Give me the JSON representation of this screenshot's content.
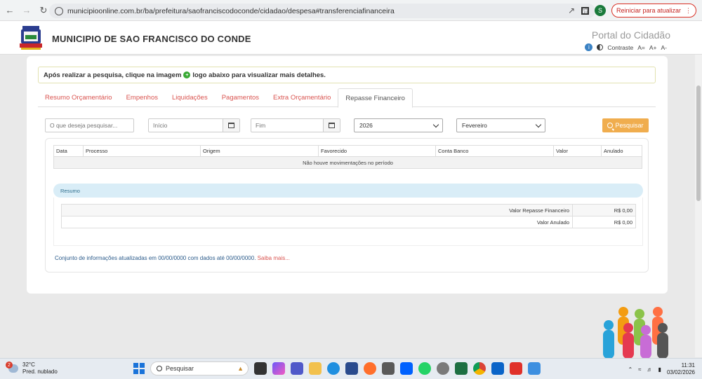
{
  "browser": {
    "url": "municipioonline.com.br/ba/prefeitura/saofranciscodoconde/cidadao/despesa#transferenciafinanceira",
    "profile_initial": "S",
    "restart_label": "Reiniciar para atualizar"
  },
  "header": {
    "municipality": "MUNICIPIO DE SAO FRANCISCO DO CONDE",
    "portal": "Portal do Cidadão",
    "contrast_label": "Contraste",
    "font_normal": "A=",
    "font_increase": "A+",
    "font_decrease": "A-"
  },
  "notice": {
    "before": "Após realizar a pesquisa, clique na imagem",
    "after": "logo abaixo para visualizar mais detalhes."
  },
  "tabs": [
    {
      "label": "Resumo Orçamentário",
      "active": false
    },
    {
      "label": "Empenhos",
      "active": false
    },
    {
      "label": "Liquidações",
      "active": false
    },
    {
      "label": "Pagamentos",
      "active": false
    },
    {
      "label": "Extra Orçamentário",
      "active": false
    },
    {
      "label": "Repasse Financeiro",
      "active": true
    }
  ],
  "filters": {
    "search_placeholder": "O que deseja pesquisar...",
    "start_placeholder": "Início",
    "end_placeholder": "Fim",
    "year": "2026",
    "month": "Fevereiro",
    "search_button": "Pesquisar"
  },
  "table": {
    "columns": [
      "Data",
      "Processo",
      "Origem",
      "Favorecido",
      "Conta Banco",
      "Valor",
      "Anulado"
    ],
    "empty_message": "Não houve movimentações no período"
  },
  "summary": {
    "title": "Resumo",
    "rows": [
      {
        "label": "Valor Repasse Financeiro",
        "value": "R$ 0,00"
      },
      {
        "label": "Valor Anulado",
        "value": "R$ 0,00"
      }
    ]
  },
  "footer": {
    "note": "Conjunto de informações atualizadas em 00/00/0000 com dados até 00/00/0000.",
    "more_link": "Saiba mais..."
  },
  "taskbar": {
    "notifications": "2",
    "temperature": "32°C",
    "weather": "Pred. nublado",
    "search_label": "Pesquisar",
    "time": "11:31",
    "date": "03/02/2026"
  },
  "colors": {
    "tab_link": "#d9534f",
    "search_button": "#f0ad4e",
    "summary_bar": "#d9edf7",
    "footer_text": "#2a5a8a"
  }
}
